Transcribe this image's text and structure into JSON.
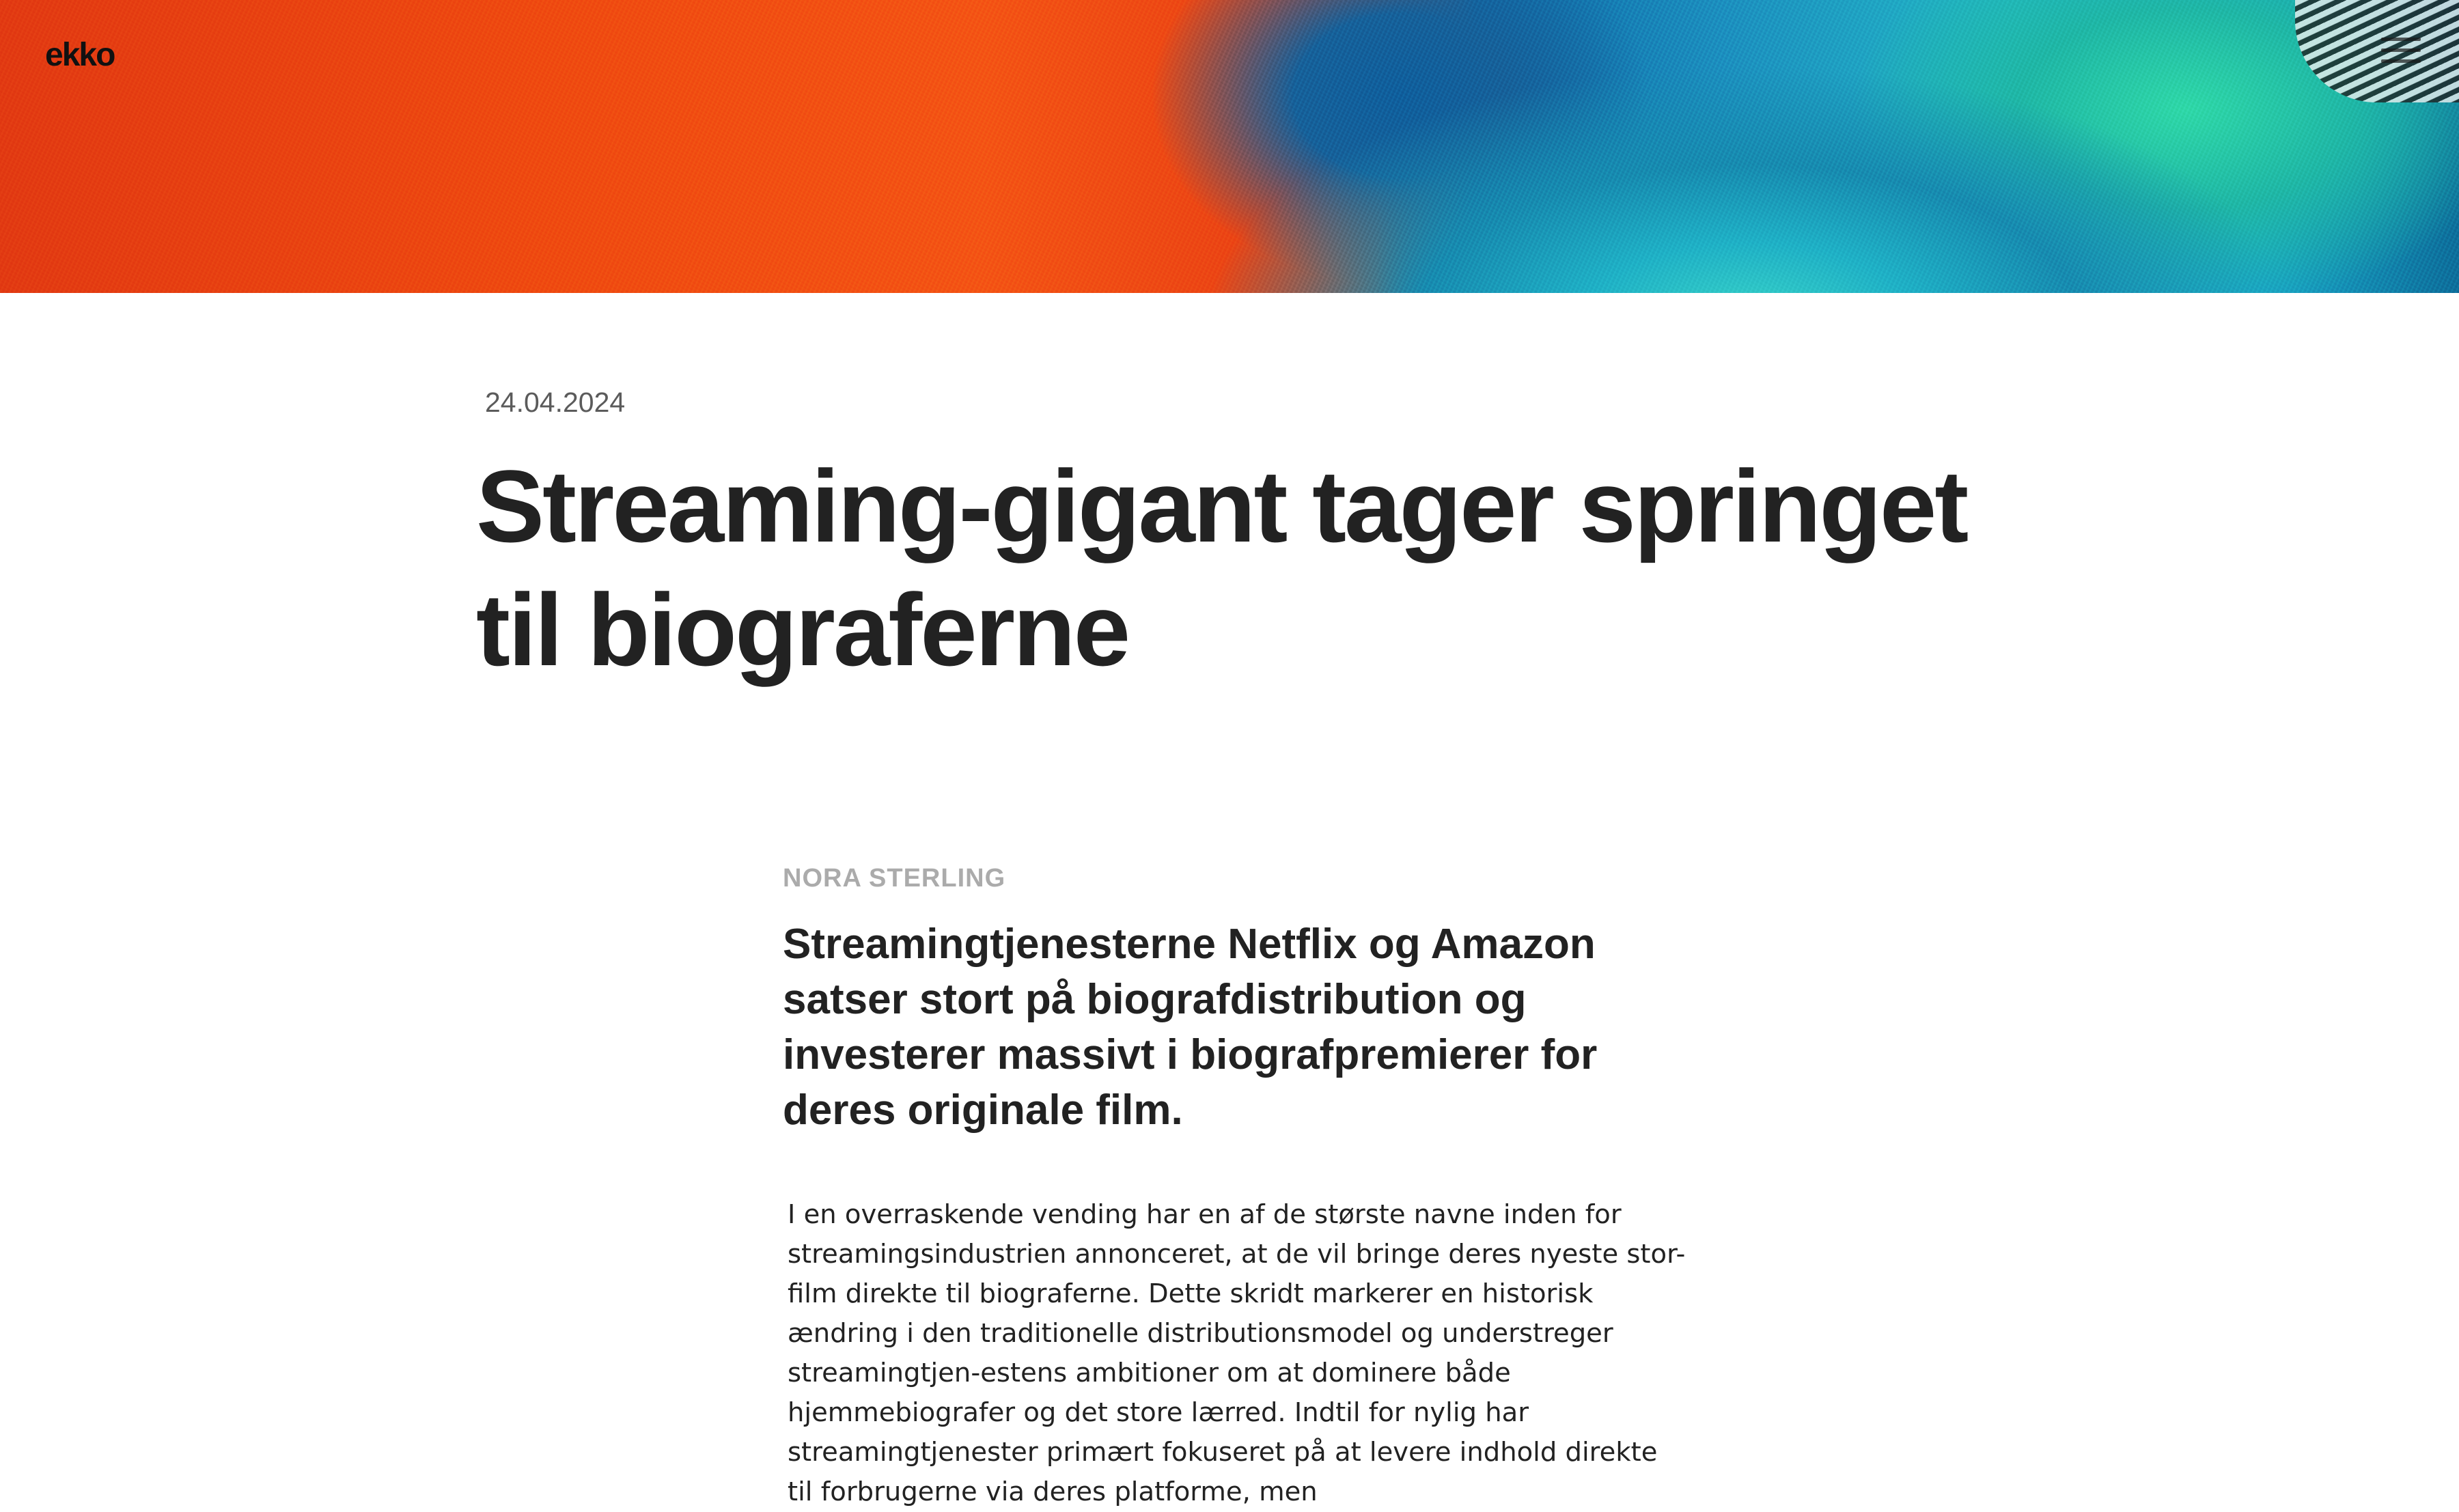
{
  "site": {
    "logo_text": "ekko",
    "menu_icon": "hamburger-menu-icon",
    "hero_image": "abstract-orange-turquoise-feather-photo"
  },
  "article": {
    "date": "24.04.2024",
    "title": "Streaming-gigant tager springet til biograferne",
    "author": "NORA STERLING",
    "lead": "Streamingtjenesterne Netflix og Amazon satser stort på biografdistribution og investerer massivt i biografpremierer for deres originale film.",
    "body": "I en overraskende vending har en af de største navne inden for streamingsindustrien annonceret, at de vil bringe deres nyeste stor-film direkte til biograferne. Dette skridt markerer en historisk ændring i den traditionelle distributionsmodel og understreger streamingtjen-estens ambitioner om at dominere både hjemmebiografer og det store lærred. Indtil for nylig har streamingtjenester primært fokuseret på at levere indhold direkte til forbrugerne via deres platforme, men"
  }
}
